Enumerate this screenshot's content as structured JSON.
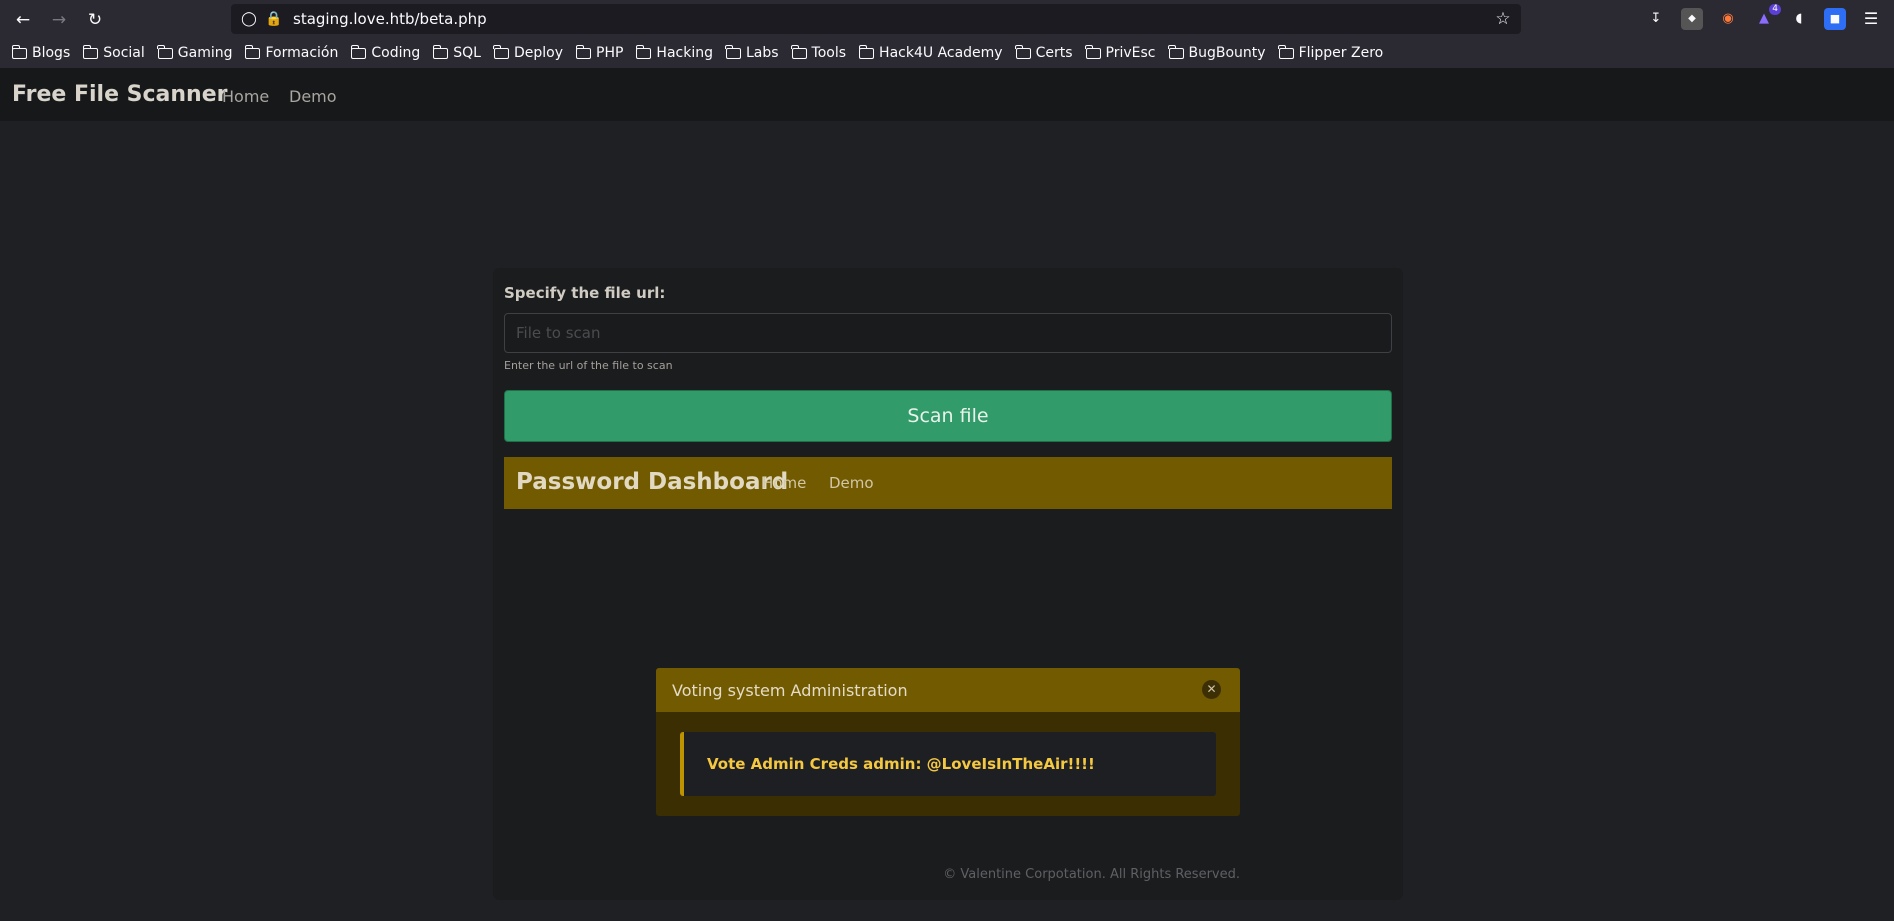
{
  "browser": {
    "url": "staging.love.htb/beta.php",
    "bookmarks": [
      "Blogs",
      "Social",
      "Gaming",
      "Formación",
      "Coding",
      "SQL",
      "Deploy",
      "PHP",
      "Hacking",
      "Labs",
      "Tools",
      "Hack4U Academy",
      "Certs",
      "PrivEsc",
      "BugBounty",
      "Flipper Zero"
    ],
    "extension_badge": "4"
  },
  "site": {
    "brand": "Free File Scanner",
    "nav": [
      "Home",
      "Demo"
    ]
  },
  "form": {
    "label": "Specify the file url:",
    "placeholder": "File to scan",
    "value": "",
    "help": "Enter the url of the file to scan",
    "button": "Scan file"
  },
  "dashboard": {
    "brand": "Password Dashboard",
    "nav": [
      "Home",
      "Demo"
    ]
  },
  "modal": {
    "title": "Voting system Administration",
    "message": "Vote Admin Creds admin: @LoveIsInTheAir!!!!"
  },
  "footer": "© Valentine Corpotation. All Rights Reserved.",
  "colors": {
    "scan_button": "#329b6a",
    "dashboard_bar": "#725a00",
    "alert_text": "#f5c842"
  }
}
